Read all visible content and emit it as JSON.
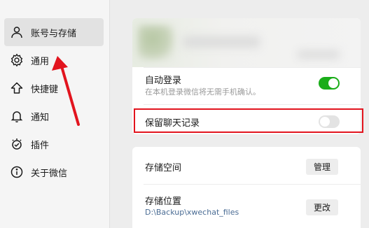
{
  "sidebar": {
    "items": [
      {
        "label": "账号与存储",
        "icon": "user-icon",
        "active": true
      },
      {
        "label": "通用",
        "icon": "gear-icon",
        "active": false
      },
      {
        "label": "快捷键",
        "icon": "shortcut-arrow-icon",
        "active": false
      },
      {
        "label": "通知",
        "icon": "bell-icon",
        "active": false
      },
      {
        "label": "插件",
        "icon": "plugin-icon",
        "active": false
      },
      {
        "label": "关于微信",
        "icon": "info-icon",
        "active": false
      }
    ]
  },
  "account": {
    "auto_login": {
      "title": "自动登录",
      "subtitle": "在本机登录微信将无需手机确认。",
      "enabled": true
    },
    "keep_history": {
      "title": "保留聊天记录",
      "enabled": false
    }
  },
  "storage": {
    "space": {
      "title": "存储空间",
      "button": "管理"
    },
    "location": {
      "title": "存储位置",
      "path": "D:\\Backup\\xwechat_files",
      "button": "更改"
    }
  },
  "colors": {
    "toggle_on": "#1aad19",
    "highlight_box": "#e2141e",
    "annotation_arrow": "#e2141e",
    "path_link": "#4a6c94"
  }
}
